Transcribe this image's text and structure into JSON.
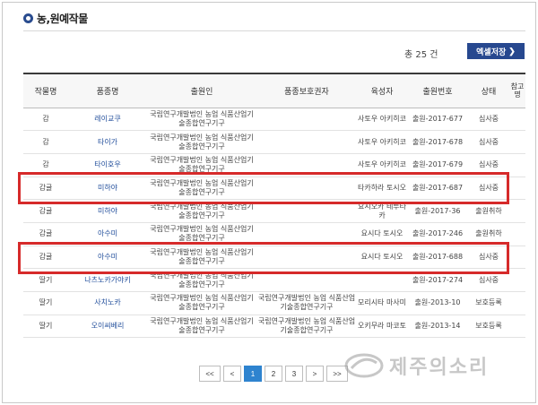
{
  "header": {
    "title": "농,원예작물"
  },
  "summary": {
    "count_label": "총 25 건"
  },
  "toolbar": {
    "excel_label": "엑셀저장",
    "excel_icon": "chevron-right-icon"
  },
  "table": {
    "columns": [
      "작물명",
      "품종명",
      "출원인",
      "품종보호권자",
      "육성자",
      "출원번호",
      "상태",
      "참고명"
    ],
    "rows": [
      {
        "crop": "감",
        "variety": "레이교쿠",
        "applicant": "국립연구개발법인 농업 식품산업기술종합연구기구",
        "holder": "",
        "breeder": "사토우 아키히코",
        "app_no": "출원-2017-677",
        "status": "심사중",
        "note": ""
      },
      {
        "crop": "감",
        "variety": "타이가",
        "applicant": "국립연구개발법인 농업 식품산업기술종합연구기구",
        "holder": "",
        "breeder": "사토우 아키히코",
        "app_no": "출원-2017-678",
        "status": "심사중",
        "note": ""
      },
      {
        "crop": "감",
        "variety": "타이호우",
        "applicant": "국립연구개발법인 농업 식품산업기술종합연구기구",
        "holder": "",
        "breeder": "사토우 아키히코",
        "app_no": "출원-2017-679",
        "status": "심사중",
        "note": ""
      },
      {
        "crop": "감귤",
        "variety": "미하야",
        "applicant": "국립연구개발법인 농업 식품산업기술종합연구기구",
        "holder": "",
        "breeder": "타카하라 토시오",
        "app_no": "출원-2017-687",
        "status": "심사중",
        "note": ""
      },
      {
        "crop": "감귤",
        "variety": "미하야",
        "applicant": "국립연구개발법인 농업 식품산업기술종합연구기구",
        "holder": "",
        "breeder": "요시오카 테루타카",
        "app_no": "출원-2017-36",
        "status": "출원취하",
        "note": ""
      },
      {
        "crop": "감귤",
        "variety": "아수미",
        "applicant": "국립연구개발법인 농업 식품산업기술종합연구기구",
        "holder": "",
        "breeder": "요시다 토시오",
        "app_no": "출원-2017-246",
        "status": "출원취하",
        "note": ""
      },
      {
        "crop": "감귤",
        "variety": "아수미",
        "applicant": "국립연구개발법인 농업 식품산업기술종합연구기구",
        "holder": "",
        "breeder": "요시다 토시오",
        "app_no": "출원-2017-688",
        "status": "심사중",
        "note": ""
      },
      {
        "crop": "딸기",
        "variety": "나츠노카가야키",
        "applicant": "국립연구개발법인 농업 식품산업기술종합연구기구",
        "holder": "",
        "breeder": "",
        "app_no": "출원-2017-274",
        "status": "심사중",
        "note": ""
      },
      {
        "crop": "딸기",
        "variety": "사치노카",
        "applicant": "국립연구개발법인 농업 식품산업기술종합연구기구",
        "holder": "국립연구개발법인 농업 식품산업기술종합연구기구",
        "breeder": "모리시타 마사미",
        "app_no": "출원-2013-10",
        "status": "보호등록",
        "note": ""
      },
      {
        "crop": "딸기",
        "variety": "오이씨베리",
        "applicant": "국립연구개발법인 농업 식품산업기술종합연구기구",
        "holder": "국립연구개발법인 농업 식품산업기술종합연구기구",
        "breeder": "오키무라 마코토",
        "app_no": "출원-2013-14",
        "status": "보호등록",
        "note": ""
      }
    ]
  },
  "pagination": {
    "first": "<<",
    "prev": "<",
    "pages": [
      "1",
      "2",
      "3"
    ],
    "current": "1",
    "next": ">",
    "last": ">>"
  },
  "watermark": {
    "text": "제주의소리"
  },
  "colors": {
    "accent": "#27488f",
    "highlight": "#d62a2a",
    "link": "#1f4c9a",
    "page_active": "#2e83cf"
  }
}
